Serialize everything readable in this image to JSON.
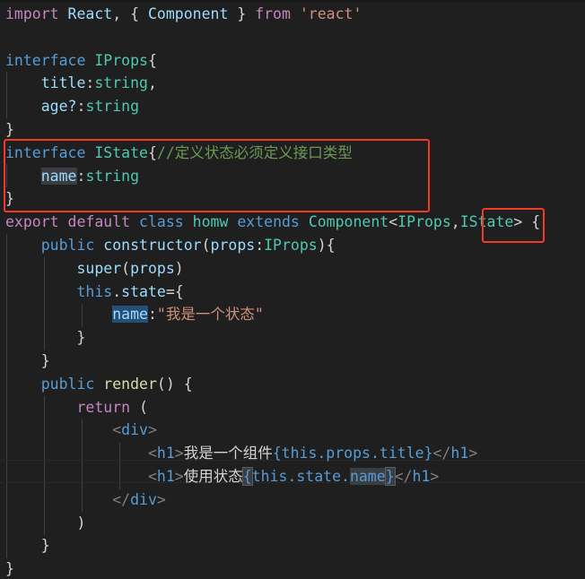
{
  "editor": {
    "language": "typescript-react",
    "theme": "dark-plus",
    "background_color": "#1f1f1f",
    "font_size_px": 16.5,
    "cursor_line_number": 19
  },
  "colors": {
    "keyword": "#c586c0",
    "control": "#569cd6",
    "identifier": "#9cdcfe",
    "type": "#4ec9b0",
    "comment": "#6a9955",
    "string": "#ce9178",
    "function": "#dcdcaa",
    "plain": "#d4d4d4",
    "jsx_bracket": "#808080",
    "selection": "#264f78",
    "word_highlight": "#3a3d41",
    "annotation_red": "#f03a2a",
    "indent_guide": "#404040",
    "current_line_border": "#282828"
  },
  "code": {
    "lines": [
      "import React, { Component } from 'react'",
      "",
      "interface IProps{",
      "    title:string,",
      "    age?:string",
      "}",
      "interface IState{//定义状态必须定义接口类型",
      "    name:string",
      "}",
      "export default class homw extends Component<IProps,IState> {",
      "    public constructor(props:IProps){",
      "        super(props)",
      "        this.state={",
      "            name:\"我是一个状态\"",
      "        }",
      "    }",
      "    public render() {",
      "        return (",
      "            <div>",
      "                <h1>我是一个组件{this.props.title}</h1>",
      "                <h1>使用状态{this.state.name}</h1>",
      "            </div>",
      "        )",
      "    }",
      "}"
    ]
  },
  "tokens": {
    "import": "import",
    "react_ident": "React",
    "comma": ",",
    "brace_open_sp": " { ",
    "component": "Component",
    "brace_close_sp": " } ",
    "from": "from",
    "react_string": "'react'",
    "interface": "interface",
    "iprops": "IProps",
    "istate": "IState",
    "brace_open": "{",
    "brace_close": "}",
    "title_key": "title",
    "age_key": "age?",
    "colon": ":",
    "string_type": "string",
    "comment_istate": "//定义状态必须定义接口类型",
    "name_key": "name",
    "export": "export",
    "default": "default",
    "class": "class",
    "class_name": "homw",
    "extends": "extends",
    "generic_open": "<",
    "generic_close": ">",
    "public": "public",
    "constructor": "constructor",
    "paren_open": "(",
    "paren_close": ")",
    "props_param": "props",
    "super": "super",
    "this": "this",
    "dot": ".",
    "state": "state",
    "equals": "=",
    "state_string": "\"我是一个状态\"",
    "render": "render",
    "return": "return",
    "div_open": "<div>",
    "div_close": "</div>",
    "h1_open": "<h1>",
    "h1_close": "</h1>",
    "chinese_component": "我是一个组件",
    "chinese_state": "使用状态",
    "expr_props_title": "{this.props.title}",
    "expr_state_name": "{this.state.name}",
    "props": "props",
    "title": "title",
    "name": "name",
    "lt": "<",
    "gt": ">",
    "h1": "h1",
    "div": "div",
    "slash": "/"
  },
  "annotations": [
    {
      "name": "istate-interface-box",
      "shape": "rectangle",
      "color": "#f03a2a",
      "target": "interface IState block"
    },
    {
      "name": "istate-generic-box",
      "shape": "rectangle",
      "color": "#f03a2a",
      "target": "IState type argument"
    }
  ]
}
